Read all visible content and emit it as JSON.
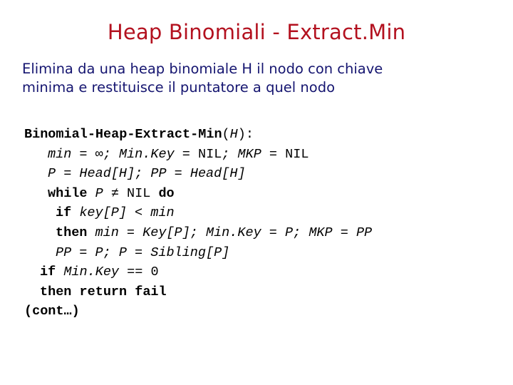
{
  "slide": {
    "title": "Heap Binomiali - Extract.Min",
    "title_color": "#b3111f",
    "subtitle_color": "#151570",
    "code_color": "#000000",
    "background": "#ffffff"
  },
  "subtitle": {
    "line1": "Elimina da una heap binomiale H il nodo con chiave",
    "line2": "minima e restituisce il puntatore a quel nodo"
  },
  "code": {
    "line1_name": "Binomial-Heap-Extract-Min",
    "line1_open": "(",
    "line1_arg": "H",
    "line1_close": "):",
    "line2_a": "min = ",
    "line2_inf": "∞",
    "line2_b": "; ",
    "line2_c": "Min.Key",
    "line2_d": " = ",
    "line2_e": "NIL",
    "line2_f": "; ",
    "line2_g": "MKP",
    "line2_h": " = ",
    "line2_i": "NIL",
    "line3_a": "P = Head[H]",
    "line3_b": "; ",
    "line3_c": "PP = Head[H]",
    "line4_kw1": "while",
    "line4_var": " P ",
    "line4_neq": "≠",
    "line4_nil": " NIL ",
    "line4_kw2": "do",
    "line5_kw": "if",
    "line5_expr": " key[P] < min",
    "line6_kw": "then",
    "line6_a": " min = Key[P]",
    "line6_b": "; ",
    "line6_c": "Min.Key",
    "line6_d": " = ",
    "line6_e": "P",
    "line6_f": "; ",
    "line6_g": "MKP",
    "line6_h": " = ",
    "line6_i": "PP",
    "line7_a": "PP = P",
    "line7_b": "; ",
    "line7_c": "P = Sibling[P]",
    "line8_kw": "if",
    "line8_a": " Min.Key",
    "line8_b": " == ",
    "line8_c": "0",
    "line9_kw": "then return fail",
    "line10": "(cont…)"
  }
}
